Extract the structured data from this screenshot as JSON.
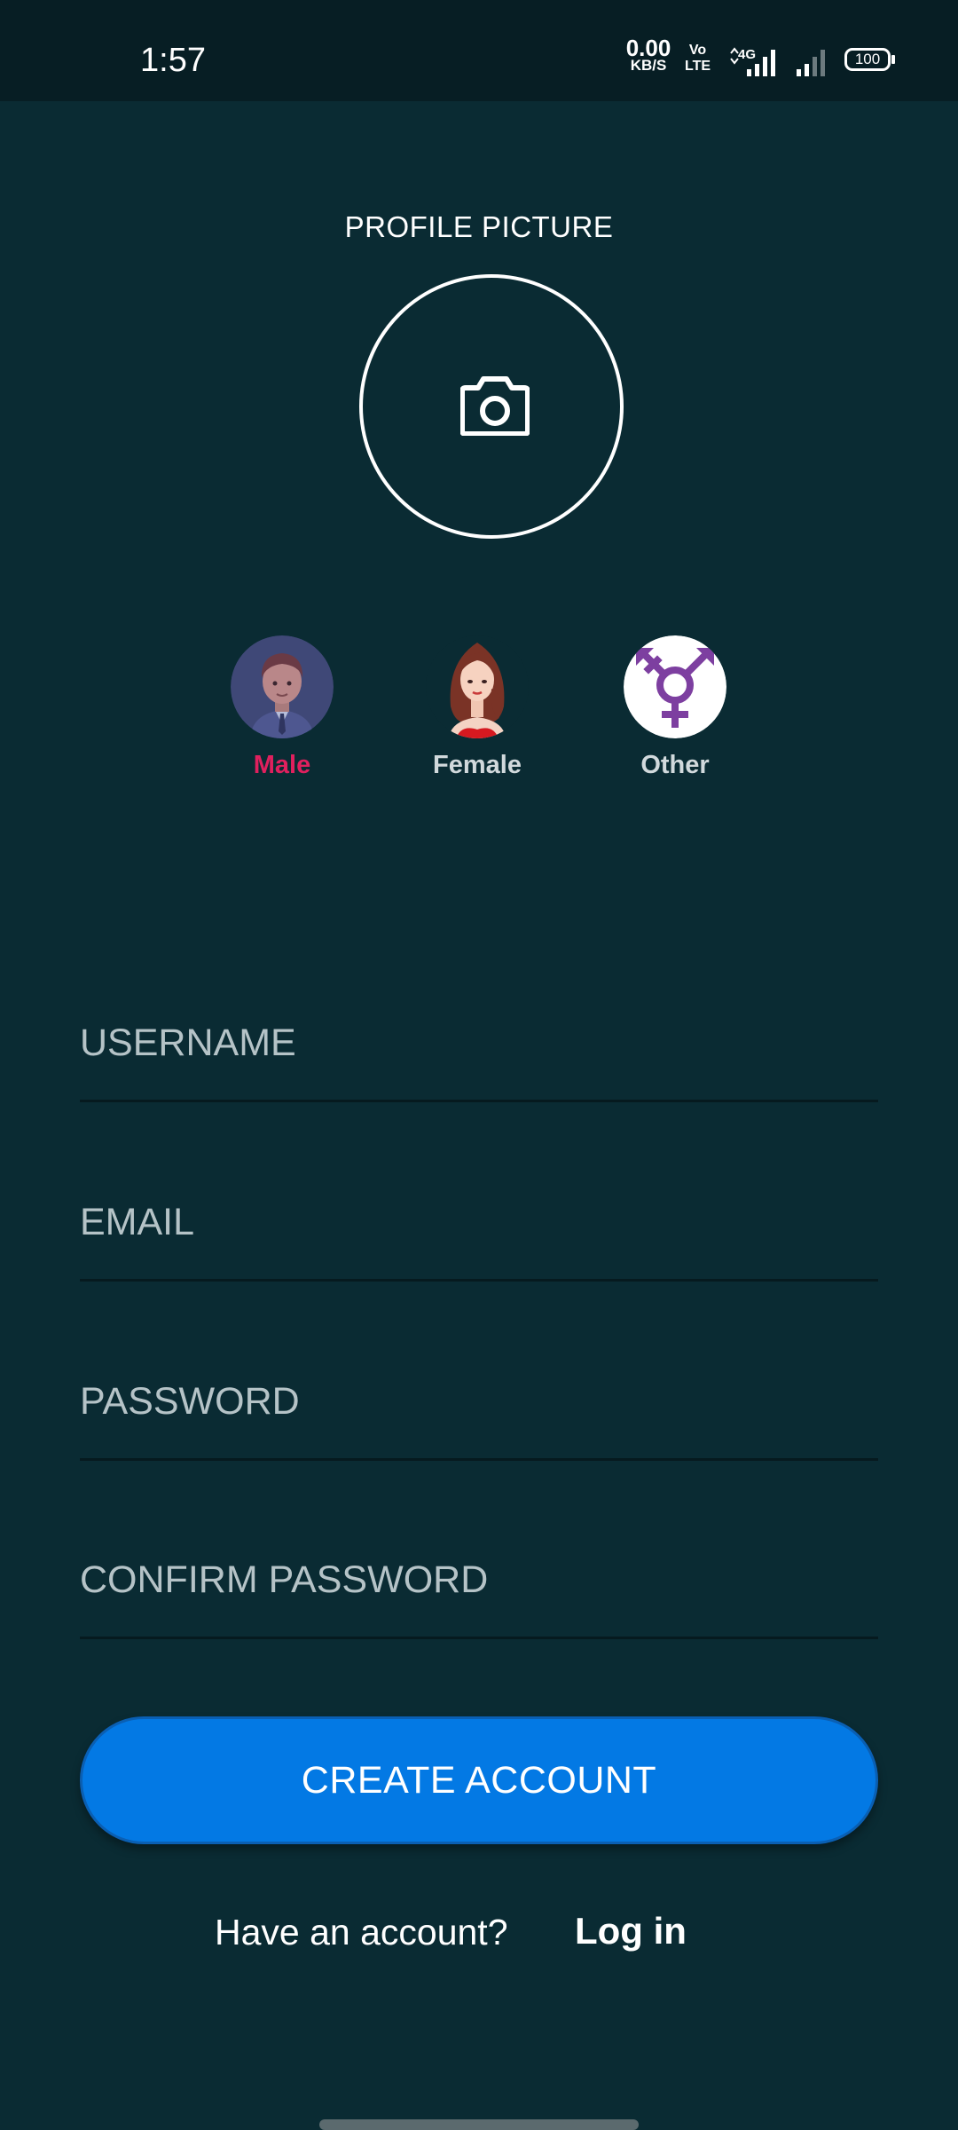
{
  "status_bar": {
    "time": "1:57",
    "net_speed_value": "0.00",
    "net_speed_unit": "KB/S",
    "volte_top": "Vo",
    "volte_bottom": "LTE",
    "network": "4G",
    "battery": "100"
  },
  "profile": {
    "label": "PROFILE PICTURE",
    "camera_icon": "camera-icon"
  },
  "gender": {
    "options": [
      {
        "label": "Male",
        "icon": "male-avatar-icon",
        "selected": true
      },
      {
        "label": "Female",
        "icon": "female-avatar-icon",
        "selected": false
      },
      {
        "label": "Other",
        "icon": "transgender-symbol-icon",
        "selected": false
      }
    ],
    "selected_color": "#e0205e"
  },
  "form": {
    "username_placeholder": "USERNAME",
    "email_placeholder": "EMAIL",
    "password_placeholder": "PASSWORD",
    "confirm_password_placeholder": "CONFIRM PASSWORD",
    "create_button": "CREATE ACCOUNT"
  },
  "footer": {
    "prompt": "Have an account?",
    "login_link": "Log in"
  },
  "colors": {
    "background": "#0a2b33",
    "status_bar": "#071e24",
    "button": "#0379e4",
    "accent_purple": "#7d3fa0"
  }
}
